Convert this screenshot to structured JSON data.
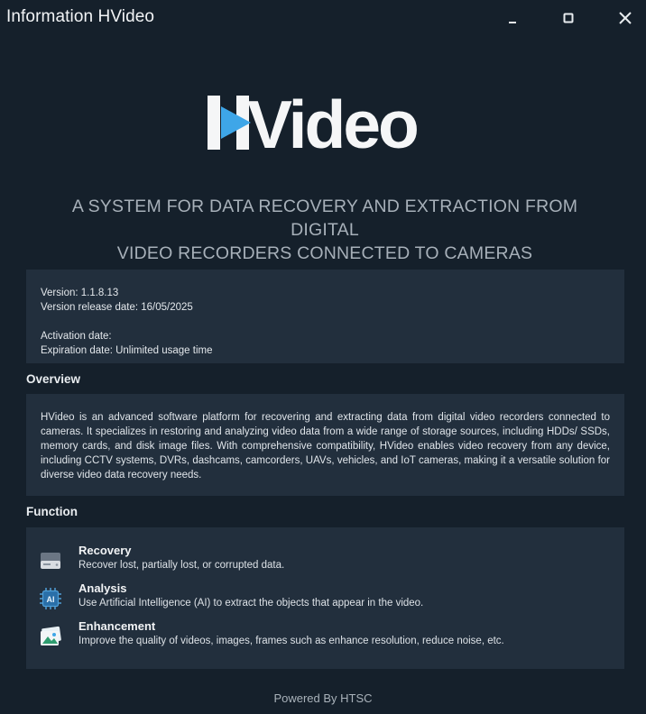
{
  "window": {
    "title": "Information HVideo",
    "controls": {
      "minimize_icon": "minimize-icon",
      "maximize_icon": "maximize-icon",
      "close_icon": "close-icon"
    }
  },
  "brand": {
    "logo_text": "HVideo",
    "accent_color": "#3ea6e8",
    "tagline_line1": "A SYSTEM FOR DATA RECOVERY AND EXTRACTION FROM DIGITAL",
    "tagline_line2": "VIDEO RECORDERS CONNECTED TO CAMERAS"
  },
  "info": {
    "version": "Version: 1.1.8.13",
    "release_date": "Version release date: 16/05/2025",
    "activation_date": "Activation date:",
    "expiration_date": "Expiration date:  Unlimited usage time"
  },
  "overview": {
    "title": "Overview",
    "text": "HVideo is an advanced software platform for recovering and extracting data from digital video recorders connected to cameras. It specializes in restoring and analyzing video data from a wide range of storage sources, including HDDs/ SSDs, memory cards, and disk image files. With comprehensive compatibility, HVideo enables video recovery from any device, including CCTV systems, DVRs, dashcams, camcorders, UAVs, vehicles, and IoT cameras, making it a versatile solution for diverse video data recovery needs."
  },
  "function": {
    "title": "Function",
    "items": [
      {
        "name": "Recovery",
        "desc": "Recover lost, partially lost, or corrupted data.",
        "icon": "hard-drive-icon"
      },
      {
        "name": "Analysis",
        "desc": "Use Artificial Intelligence (AI) to extract the objects that appear in the video.",
        "icon": "ai-chip-icon"
      },
      {
        "name": "Enhancement",
        "desc": "Improve the quality of videos, images, frames such as enhance resolution, reduce noise, etc.",
        "icon": "image-icon"
      }
    ]
  },
  "footer": {
    "text": "Powered By HTSC"
  }
}
